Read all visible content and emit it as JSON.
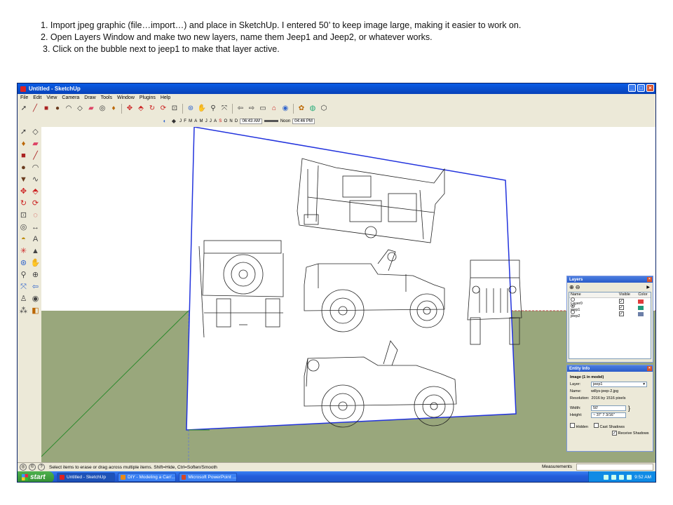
{
  "instructions": {
    "line1": "1. Import jpeg graphic (file…import…) and place in SketchUp. I entered 50’ to keep image large, making it easier to work on.",
    "line2": "2. Open Layers Window and make two new layers, name them Jeep1 and Jeep2, or whatever works.",
    "line3": "3. Click on the bubble next to jeep1 to make that layer active."
  },
  "window": {
    "title": "Untitled - SketchUp",
    "menu": [
      "File",
      "Edit",
      "View",
      "Camera",
      "Draw",
      "Tools",
      "Window",
      "Plugins",
      "Help"
    ]
  },
  "shadow_toolbar": {
    "months": [
      "J",
      "F",
      "M",
      "A",
      "M",
      "J",
      "J",
      "A",
      "S",
      "O",
      "N",
      "D"
    ],
    "time_start": "06:43 AM",
    "time_mid": "Noon",
    "time_end": "04:46 PM"
  },
  "layers_panel": {
    "title": "Layers",
    "col_name": "Name",
    "col_visible": "Visible",
    "col_color": "Color",
    "rows": [
      {
        "name": "Layer0",
        "active": false,
        "visible": true,
        "color": "#e03c3c"
      },
      {
        "name": "jeep1",
        "active": true,
        "visible": true,
        "color": "#1f9a7a"
      },
      {
        "name": "jeep2",
        "active": false,
        "visible": true,
        "color": "#6c7fa8"
      }
    ]
  },
  "entity_info": {
    "title": "Entity Info",
    "heading": "Image (1 in model)",
    "layer_label": "Layer:",
    "layer_value": "jeep1",
    "name_label": "Name:",
    "name_value": "willys-jeep-2.jpg",
    "resolution_label": "Resolution:",
    "resolution_value": "2016 by 1516 pixels",
    "width_label": "Width:",
    "width_value": "50'",
    "height_label": "Height:",
    "height_value": "~ 37' 7 3/16\"",
    "hidden_label": "Hidden",
    "cast_label": "Cast Shadows",
    "receive_label": "Receive Shadows"
  },
  "status_bar": {
    "message": "Select items to erase or drag across multiple items. Shift=Hide, Ctrl=Soften/Smooth",
    "measurements_label": "Measurements"
  },
  "taskbar": {
    "start": "start",
    "tasks": [
      "Untitled - SketchUp",
      "DIY - Modeling a Car/...",
      "Microsoft PowerPoint ..."
    ],
    "clock": "9:52 AM"
  },
  "colors": {
    "ground": "#99a77c",
    "image_edge": "#2233dd",
    "xp_blue": "#245edb"
  }
}
